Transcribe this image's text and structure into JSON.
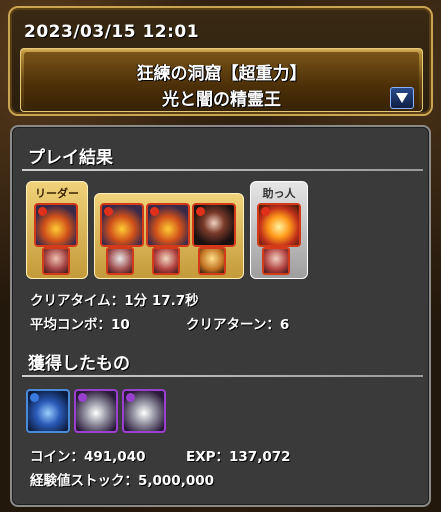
{
  "header": {
    "datetime": "2023/03/15 12:01",
    "dungeon_name": "狂練の洞窟【超重力】",
    "floor_name": "光と闇の精霊王"
  },
  "results": {
    "section_title": "プレイ結果",
    "leader_label": "リーダー",
    "helper_label": "助っ人",
    "clear_time": "クリアタイム：1分 17.7秒",
    "avg_combo": "平均コンボ：10",
    "clear_turns": "クリアターン：6"
  },
  "drops": {
    "section_title": "獲得したもの",
    "coin": "コイン：491,040",
    "exp": "EXP：137,072",
    "exp_stock": "経験値ストック：5,000,000"
  },
  "colors": {
    "fire": "#d23a1a",
    "dark": "#9a40d0",
    "water": "#4a8ad8",
    "gold_frame": "#e0b85a"
  }
}
